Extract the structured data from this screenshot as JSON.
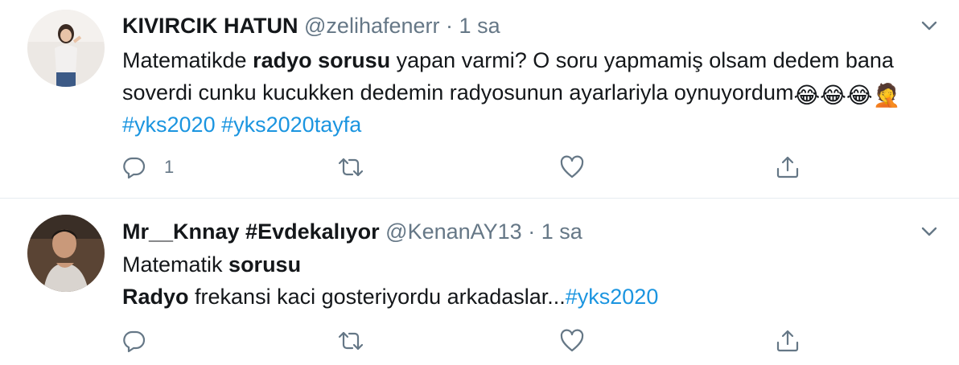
{
  "colors": {
    "link": "#1b95e0",
    "text": "#14171a",
    "secondary": "#657786",
    "divider": "#e6ecf0"
  },
  "tweets": [
    {
      "name": "KIVIRCIK HATUN",
      "handle": "@zelihafenerr",
      "separator": "·",
      "time": "1 sa",
      "body": {
        "t1": "Matematikde ",
        "b1": "radyo sorusu",
        "t2": " yapan varmi?  O soru yapmamiş olsam dedem bana soverdi cunku kucukken dedemin radyosunun ayarlariyla oynuyordum",
        "emoji": "😂😂😂🤦",
        "h1": "#yks2020",
        "h2": "#yks2020tayfa"
      },
      "reply_count": "1",
      "icons": [
        "reply-icon",
        "retweet-icon",
        "like-icon",
        "share-icon",
        "chevron-down-icon"
      ]
    },
    {
      "name": "Mr__Knnay #Evdekalıyor",
      "handle": "@KenanAY13",
      "separator": "·",
      "time": "1 sa",
      "body": {
        "t1": "Matematik ",
        "b1": "sorusu",
        "b2": "Radyo",
        "t2": " frekansi kaci gosteriyordu arkadaslar...",
        "h1": "#yks2020"
      },
      "reply_count": "",
      "icons": [
        "reply-icon",
        "retweet-icon",
        "like-icon",
        "share-icon",
        "chevron-down-icon"
      ]
    }
  ]
}
